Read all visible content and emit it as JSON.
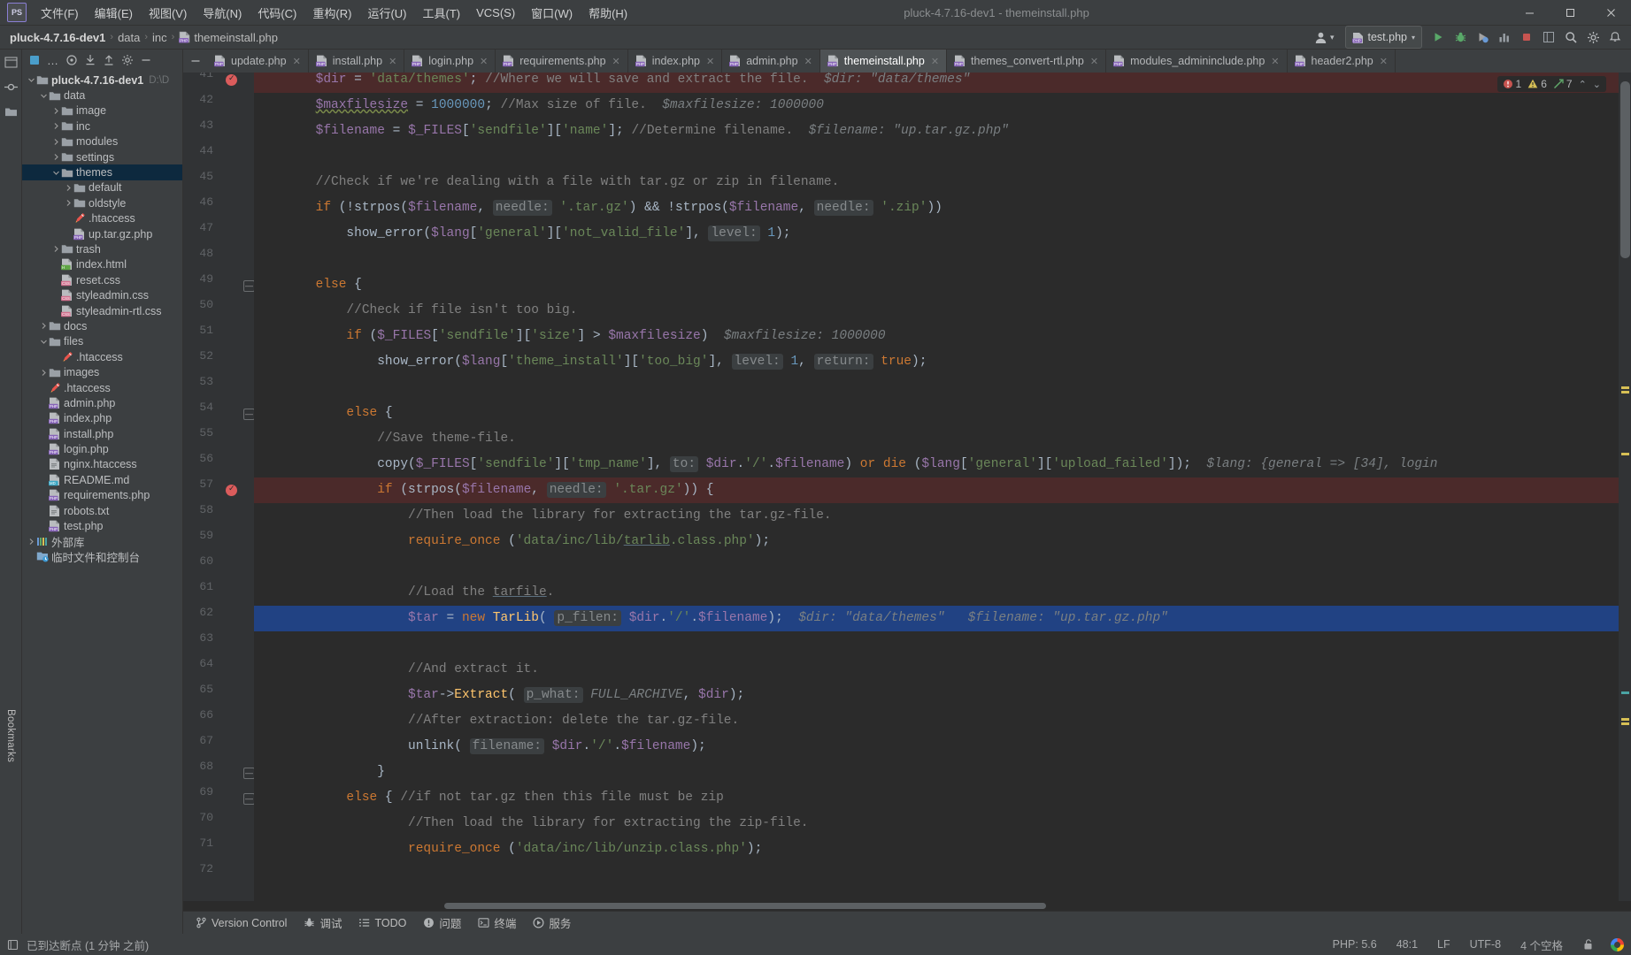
{
  "window": {
    "title": "pluck-4.7.16-dev1 - themeinstall.php",
    "logo_text": "PS",
    "minimize": "—",
    "maximize": "☐",
    "close": "✕"
  },
  "menubar": {
    "items": [
      {
        "label": "文件(F)",
        "name": "menu-file"
      },
      {
        "label": "编辑(E)",
        "name": "menu-edit"
      },
      {
        "label": "视图(V)",
        "name": "menu-view"
      },
      {
        "label": "导航(N)",
        "name": "menu-navigate"
      },
      {
        "label": "代码(C)",
        "name": "menu-code"
      },
      {
        "label": "重构(R)",
        "name": "menu-refactor"
      },
      {
        "label": "运行(U)",
        "name": "menu-run"
      },
      {
        "label": "工具(T)",
        "name": "menu-tools"
      },
      {
        "label": "VCS(S)",
        "name": "menu-vcs"
      },
      {
        "label": "窗口(W)",
        "name": "menu-window"
      },
      {
        "label": "帮助(H)",
        "name": "menu-help"
      }
    ]
  },
  "breadcrumb": {
    "project": "pluck-4.7.16-dev1",
    "parts": [
      "data",
      "inc"
    ],
    "file": "themeinstall.php",
    "separator": "›"
  },
  "navbar_right": {
    "run_config": "test.php",
    "run_config_icon": "php-run-icon",
    "chevron": "▾",
    "icons": [
      {
        "name": "run-icon"
      },
      {
        "name": "debug-icon"
      },
      {
        "name": "run-coverage-icon"
      },
      {
        "name": "profiler-icon"
      },
      {
        "name": "stop-icon"
      },
      {
        "name": "layout-icon"
      },
      {
        "name": "search-everywhere-icon"
      },
      {
        "name": "settings-icon"
      },
      {
        "name": "updates-icon"
      }
    ]
  },
  "left_rail": {
    "top_icons": [
      "project-icon",
      "commit-icon",
      "folder-icon"
    ],
    "bottom_label": "Bookmarks"
  },
  "project_panel": {
    "toolbar_icons": [
      {
        "name": "project-view-selector-icon",
        "glyph": "■"
      },
      {
        "name": "more-options-icon",
        "glyph": "…"
      },
      {
        "name": "locate-icon",
        "glyph": "◎"
      },
      {
        "name": "expand-all-icon",
        "glyph": "⤓"
      },
      {
        "name": "collapse-all-icon",
        "glyph": "⤒"
      },
      {
        "name": "settings-gear-icon",
        "glyph": "⚙"
      },
      {
        "name": "hide-panel-icon",
        "glyph": "—"
      }
    ],
    "tree": [
      {
        "label": "pluck-4.7.16-dev1",
        "path": "D:\\D",
        "depth": 0,
        "arrow": "down",
        "icon": "folder",
        "bold": true
      },
      {
        "label": "data",
        "depth": 1,
        "arrow": "down",
        "icon": "folder"
      },
      {
        "label": "image",
        "depth": 2,
        "arrow": "right",
        "icon": "folder"
      },
      {
        "label": "inc",
        "depth": 2,
        "arrow": "right",
        "icon": "folder"
      },
      {
        "label": "modules",
        "depth": 2,
        "arrow": "right",
        "icon": "folder"
      },
      {
        "label": "settings",
        "depth": 2,
        "arrow": "right",
        "icon": "folder"
      },
      {
        "label": "themes",
        "depth": 2,
        "arrow": "down",
        "icon": "folder",
        "selected": true
      },
      {
        "label": "default",
        "depth": 3,
        "arrow": "right",
        "icon": "folder"
      },
      {
        "label": "oldstyle",
        "depth": 3,
        "arrow": "right",
        "icon": "folder"
      },
      {
        "label": ".htaccess",
        "depth": 3,
        "arrow": "none",
        "icon": "htaccess"
      },
      {
        "label": "up.tar.gz.php",
        "depth": 3,
        "arrow": "none",
        "icon": "php"
      },
      {
        "label": "trash",
        "depth": 2,
        "arrow": "right",
        "icon": "folder"
      },
      {
        "label": "index.html",
        "depth": 2,
        "arrow": "none",
        "icon": "html"
      },
      {
        "label": "reset.css",
        "depth": 2,
        "arrow": "none",
        "icon": "css"
      },
      {
        "label": "styleadmin.css",
        "depth": 2,
        "arrow": "none",
        "icon": "css"
      },
      {
        "label": "styleadmin-rtl.css",
        "depth": 2,
        "arrow": "none",
        "icon": "css"
      },
      {
        "label": "docs",
        "depth": 1,
        "arrow": "right",
        "icon": "folder"
      },
      {
        "label": "files",
        "depth": 1,
        "arrow": "down",
        "icon": "folder"
      },
      {
        "label": ".htaccess",
        "depth": 2,
        "arrow": "none",
        "icon": "htaccess"
      },
      {
        "label": "images",
        "depth": 1,
        "arrow": "right",
        "icon": "folder"
      },
      {
        "label": ".htaccess",
        "depth": 1,
        "arrow": "none",
        "icon": "htaccess"
      },
      {
        "label": "admin.php",
        "depth": 1,
        "arrow": "none",
        "icon": "php"
      },
      {
        "label": "index.php",
        "depth": 1,
        "arrow": "none",
        "icon": "php"
      },
      {
        "label": "install.php",
        "depth": 1,
        "arrow": "none",
        "icon": "php"
      },
      {
        "label": "login.php",
        "depth": 1,
        "arrow": "none",
        "icon": "php"
      },
      {
        "label": "nginx.htaccess",
        "depth": 1,
        "arrow": "none",
        "icon": "text"
      },
      {
        "label": "README.md",
        "depth": 1,
        "arrow": "none",
        "icon": "md"
      },
      {
        "label": "requirements.php",
        "depth": 1,
        "arrow": "none",
        "icon": "php"
      },
      {
        "label": "robots.txt",
        "depth": 1,
        "arrow": "none",
        "icon": "text"
      },
      {
        "label": "test.php",
        "depth": 1,
        "arrow": "none",
        "icon": "php"
      },
      {
        "label": "外部库",
        "depth": 0,
        "arrow": "right",
        "icon": "library"
      },
      {
        "label": "临时文件和控制台",
        "depth": 0,
        "arrow": "none",
        "icon": "scratch"
      }
    ]
  },
  "editor_tabs": {
    "hide_glyph": "—",
    "tabs": [
      {
        "label": "update.php",
        "active": false
      },
      {
        "label": "install.php",
        "active": false
      },
      {
        "label": "login.php",
        "active": false
      },
      {
        "label": "requirements.php",
        "active": false
      },
      {
        "label": "index.php",
        "active": false
      },
      {
        "label": "admin.php",
        "active": false
      },
      {
        "label": "themeinstall.php",
        "active": true
      },
      {
        "label": "themes_convert-rtl.php",
        "active": false
      },
      {
        "label": "modules_admininclude.php",
        "active": false
      },
      {
        "label": "header2.php",
        "active": false
      }
    ],
    "close_glyph": "✕"
  },
  "inspections": {
    "error_icon": "error-icon",
    "error_count": "1",
    "warning_icon": "warning-icon",
    "warning_count": "6",
    "weak_icon": "weak-warning-icon",
    "weak_count": "7",
    "up_glyph": "⌃",
    "down_glyph": "⌄"
  },
  "editor": {
    "first_line": 41,
    "breakpoint_lines": [
      41,
      57
    ],
    "highlight_line": 41,
    "caret_line": 62,
    "fold_lines": [
      49,
      54,
      68,
      69
    ],
    "lines": [
      {
        "n": 41,
        "html": "        <span class=\"v\">$dir</span><span class=\"d\"> = </span><span class=\"s\">'data/themes'</span><span class=\"d\">; </span><span class=\"c\">//Where we will save and extract the file.</span>  <span class=\"inlay\">$dir: \"data/themes\"</span>"
      },
      {
        "n": 42,
        "html": "        <span class=\"v wavy\">$maxfilesize</span><span class=\"d\"> = </span><span class=\"n\">1000000</span><span class=\"d\">; </span><span class=\"c\">//Max size of file.</span>  <span class=\"inlay\">$maxfilesize: 1000000</span>"
      },
      {
        "n": 43,
        "html": "        <span class=\"v\">$filename</span><span class=\"d\"> = </span><span class=\"v\">$_FILES</span><span class=\"d\">[</span><span class=\"s\">'sendfile'</span><span class=\"d\">][</span><span class=\"s\">'name'</span><span class=\"d\">]; </span><span class=\"c\">//Determine filename.</span>  <span class=\"inlay\">$filename: \"up.tar.gz.php\"</span>"
      },
      {
        "n": 44,
        "html": ""
      },
      {
        "n": 45,
        "html": "        <span class=\"c\">//Check if we're dealing with a file with tar.gz or zip in filename.</span>"
      },
      {
        "n": 46,
        "html": "        <span class=\"k\">if</span><span class=\"d\"> (!</span><span class=\"d\">strpos(</span><span class=\"v\">$filename</span><span class=\"d\">, </span><span class=\"hint\">needle:</span> <span class=\"s\">'.tar.gz'</span><span class=\"d\">) &amp;&amp; !</span><span class=\"d\">strpos(</span><span class=\"v\">$filename</span><span class=\"d\">, </span><span class=\"hint\">needle:</span> <span class=\"s\">'.zip'</span><span class=\"d\">))</span>"
      },
      {
        "n": 47,
        "html": "            <span class=\"d\">show_error(</span><span class=\"v\">$lang</span><span class=\"d\">[</span><span class=\"s\">'general'</span><span class=\"d\">][</span><span class=\"s\">'not_valid_file'</span><span class=\"d\">], </span><span class=\"hint\">level:</span> <span class=\"n\">1</span><span class=\"d\">);</span>"
      },
      {
        "n": 48,
        "html": ""
      },
      {
        "n": 49,
        "html": "        <span class=\"k\">else</span><span class=\"d\"> {</span>"
      },
      {
        "n": 50,
        "html": "            <span class=\"c\">//Check if file isn't too big.</span>"
      },
      {
        "n": 51,
        "html": "            <span class=\"k\">if</span><span class=\"d\"> (</span><span class=\"v\">$_FILES</span><span class=\"d\">[</span><span class=\"s\">'sendfile'</span><span class=\"d\">][</span><span class=\"s\">'size'</span><span class=\"d\">] &gt; </span><span class=\"v\">$maxfilesize</span><span class=\"d\">)  </span><span class=\"inlay\">$maxfilesize: 1000000</span>"
      },
      {
        "n": 52,
        "html": "                <span class=\"d\">show_error(</span><span class=\"v\">$lang</span><span class=\"d\">[</span><span class=\"s\">'theme_install'</span><span class=\"d\">][</span><span class=\"s\">'too_big'</span><span class=\"d\">], </span><span class=\"hint\">level:</span> <span class=\"n\">1</span><span class=\"d\">, </span><span class=\"hint\">return:</span> <span class=\"k\">true</span><span class=\"d\">);</span>"
      },
      {
        "n": 53,
        "html": ""
      },
      {
        "n": 54,
        "html": "            <span class=\"k\">else</span><span class=\"d\"> {</span>"
      },
      {
        "n": 55,
        "html": "                <span class=\"c\">//Save theme-file.</span>"
      },
      {
        "n": 56,
        "html": "                <span class=\"d\">copy(</span><span class=\"v\">$_FILES</span><span class=\"d\">[</span><span class=\"s\">'sendfile'</span><span class=\"d\">][</span><span class=\"s\">'tmp_name'</span><span class=\"d\">], </span><span class=\"hint\">to:</span> <span class=\"v\">$dir</span><span class=\"d\">.</span><span class=\"s\">'/'</span><span class=\"d\">.</span><span class=\"v\">$filename</span><span class=\"d\">) </span><span class=\"k\">or</span><span class=\"d\"> </span><span class=\"k\">die</span><span class=\"d\"> (</span><span class=\"v\">$lang</span><span class=\"d\">[</span><span class=\"s\">'general'</span><span class=\"d\">][</span><span class=\"s\">'upload_failed'</span><span class=\"d\">]);</span>  <span class=\"inlay\">$lang: {general =&gt; [34], login</span>"
      },
      {
        "n": 57,
        "html": "                <span class=\"k\">if</span><span class=\"d\"> (</span><span class=\"d\">strpos(</span><span class=\"v\">$filename</span><span class=\"d\">, </span><span class=\"hint\">needle:</span> <span class=\"s\">'.tar.gz'</span><span class=\"d\">)) {</span>"
      },
      {
        "n": 58,
        "html": "                    <span class=\"c\">//Then load the library for extracting the tar.gz-file.</span>"
      },
      {
        "n": 59,
        "html": "                    <span class=\"k\">require_once</span><span class=\"d\"> (</span><span class=\"s\">'data/inc/lib/</span><span class=\"s und\">tarlib</span><span class=\"s\">.class.php'</span><span class=\"d\">);</span>"
      },
      {
        "n": 60,
        "html": ""
      },
      {
        "n": 61,
        "html": "                    <span class=\"c\">//Load the </span><span class=\"c und\">tarfile</span><span class=\"c\">.</span>"
      },
      {
        "n": 62,
        "html": "                    <span class=\"v\">$tar</span><span class=\"d\"> = </span><span class=\"k\">new</span><span class=\"d\"> </span><span class=\"f\">TarLib</span><span class=\"d\">( </span><span class=\"hint\">p_filen:</span> <span class=\"v\">$dir</span><span class=\"d\">.</span><span class=\"s\">'/'</span><span class=\"d\">.</span><span class=\"v\">$filename</span><span class=\"d\">);  </span><span class=\"inlay\">$dir: \"data/themes\"</span>   <span class=\"inlay\">$filename: \"up.tar.gz.php\"</span>"
      },
      {
        "n": 63,
        "html": ""
      },
      {
        "n": 64,
        "html": "                    <span class=\"c\">//And extract it.</span>"
      },
      {
        "n": 65,
        "html": "                    <span class=\"v\">$tar</span><span class=\"d\">-&gt;</span><span class=\"f\">Extract</span><span class=\"d\">( </span><span class=\"hint\">p_what:</span> <span class=\"inlay\">FULL_ARCHIVE</span><span class=\"d\">, </span><span class=\"v\">$dir</span><span class=\"d\">);</span>"
      },
      {
        "n": 66,
        "html": "                    <span class=\"c\">//After extraction: delete the tar.gz-file.</span>"
      },
      {
        "n": 67,
        "html": "                    <span class=\"d\">unlink( </span><span class=\"hint\">filename:</span> <span class=\"v\">$dir</span><span class=\"d\">.</span><span class=\"s\">'/'</span><span class=\"d\">.</span><span class=\"v\">$filename</span><span class=\"d\">);</span>"
      },
      {
        "n": 68,
        "html": "                <span class=\"d\">}</span>"
      },
      {
        "n": 69,
        "html": "            <span class=\"k\">else</span><span class=\"d\"> { </span><span class=\"c\">//if not tar.gz then this file must be zip</span>"
      },
      {
        "n": 70,
        "html": "                    <span class=\"c\">//Then load the library for extracting the zip-file.</span>"
      },
      {
        "n": 71,
        "html": "                    <span class=\"k\">require_once</span><span class=\"d\"> (</span><span class=\"s\">'data/inc/lib/unzip.class.php'</span><span class=\"d\">);</span>"
      },
      {
        "n": 72,
        "html": ""
      }
    ]
  },
  "bottom_toolwindows": [
    {
      "label": "Version Control",
      "icon": "branch-icon"
    },
    {
      "label": "调试",
      "icon": "bug-icon"
    },
    {
      "label": "TODO",
      "icon": "list-icon"
    },
    {
      "label": "问题",
      "icon": "problems-icon"
    },
    {
      "label": "终端",
      "icon": "terminal-icon"
    },
    {
      "label": "服务",
      "icon": "services-icon"
    }
  ],
  "statusbar": {
    "left_icon": "breakpoint-reached-icon",
    "left_text": "已到达断点 (1 分钟 之前)",
    "right": [
      {
        "label": "PHP: 5.6",
        "name": "php-version"
      },
      {
        "label": "48:1",
        "name": "caret-position"
      },
      {
        "label": "LF",
        "name": "line-separator"
      },
      {
        "label": "UTF-8",
        "name": "file-encoding"
      },
      {
        "label": "4 个空格",
        "name": "indent-size"
      },
      {
        "label": "",
        "name": "lock-icon"
      },
      {
        "label": "",
        "name": "google-icon"
      }
    ]
  },
  "colors": {
    "bg": "#3c3f41",
    "editor_bg": "#2b2b2b",
    "selection": "#214283",
    "breakpoint_line": "#4b2a2a",
    "accent": "#4a88c7"
  }
}
